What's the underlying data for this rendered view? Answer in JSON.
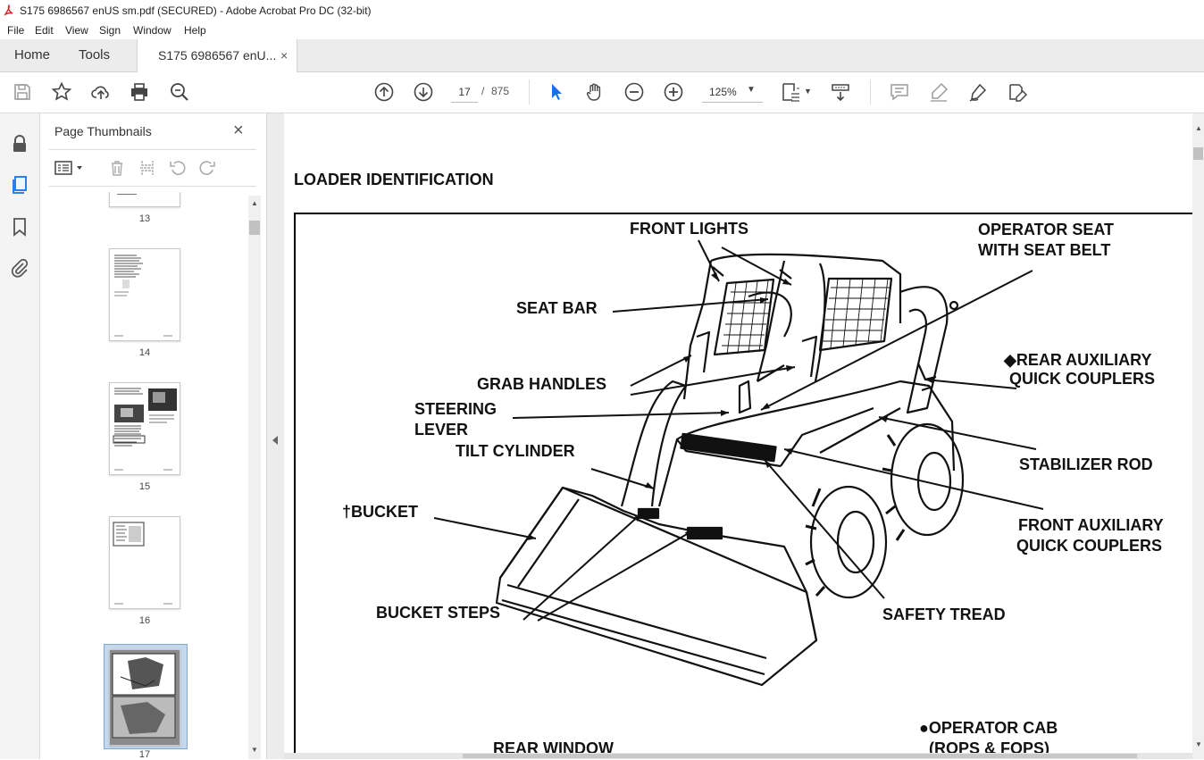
{
  "window": {
    "title": "S175 6986567 enUS sm.pdf (SECURED) - Adobe Acrobat Pro DC (32-bit)"
  },
  "menu": [
    "File",
    "Edit",
    "View",
    "Sign",
    "Window",
    "Help"
  ],
  "tabs": {
    "home": "Home",
    "tools": "Tools",
    "document": "S175 6986567 enU...",
    "close": "×"
  },
  "toolbar": {
    "current_page": "17",
    "page_sep": "/",
    "total_pages": "875",
    "zoom": "125%"
  },
  "thumbnails": {
    "title": "Page Thumbnails",
    "close": "×",
    "pages": [
      "13",
      "14",
      "15",
      "16",
      "17"
    ],
    "selected": "17"
  },
  "document": {
    "heading": "LOADER IDENTIFICATION",
    "labels": {
      "front_lights": "FRONT LIGHTS",
      "operator_seat_1": "OPERATOR SEAT",
      "operator_seat_2": "WITH SEAT BELT",
      "seat_bar": "SEAT BAR",
      "rear_aux_1": "◆REAR AUXILIARY",
      "rear_aux_2": "QUICK COUPLERS",
      "grab_handles": "GRAB HANDLES",
      "steering_1": "STEERING",
      "steering_2": "LEVER",
      "tilt_cylinder": "TILT CYLINDER",
      "stabilizer_rod": "STABILIZER ROD",
      "bucket": "†BUCKET",
      "front_aux_1": "FRONT AUXILIARY",
      "front_aux_2": "QUICK COUPLERS",
      "bucket_steps": "BUCKET STEPS",
      "safety_tread": "SAFETY TREAD",
      "operator_cab_1": "●OPERATOR CAB",
      "operator_cab_2": "(ROPS & FOPS)",
      "rear_window": "REAR WINDOW"
    }
  },
  "colors": {
    "accent": "#1473e6",
    "acrobat_red": "#d21f1f",
    "selected_thumb_bg": "#c5d8ec"
  }
}
